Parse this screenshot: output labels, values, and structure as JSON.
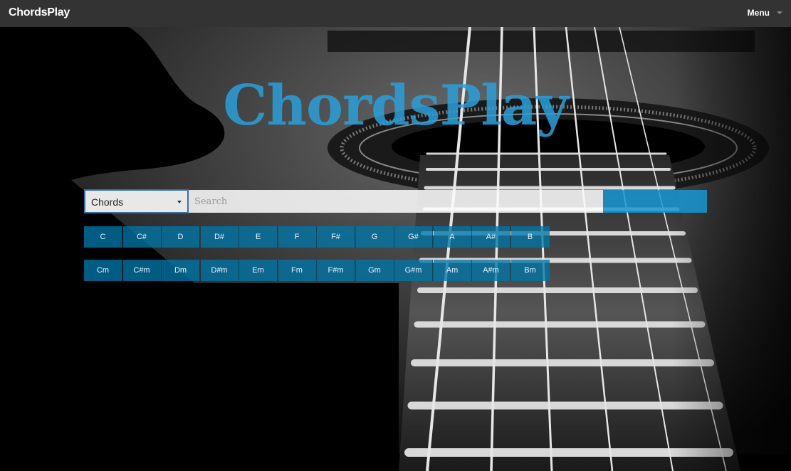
{
  "navbar": {
    "brand": "ChordsPlay",
    "menu_label": "Menu"
  },
  "hero": {
    "title": "ChordsPlay"
  },
  "search": {
    "selected_type": "Chords",
    "placeholder": "Search"
  },
  "chords": {
    "major": [
      "C",
      "C#",
      "D",
      "D#",
      "E",
      "F",
      "F#",
      "G",
      "G#",
      "A",
      "A#",
      "B"
    ],
    "minor": [
      "Cm",
      "C#m",
      "Dm",
      "D#m",
      "Em",
      "Fm",
      "F#m",
      "Gm",
      "G#m",
      "Am",
      "A#m",
      "Bm"
    ]
  },
  "colors": {
    "navbar": "#333333",
    "accent": "#2aa0d8",
    "chord_button": "#0076a8"
  }
}
